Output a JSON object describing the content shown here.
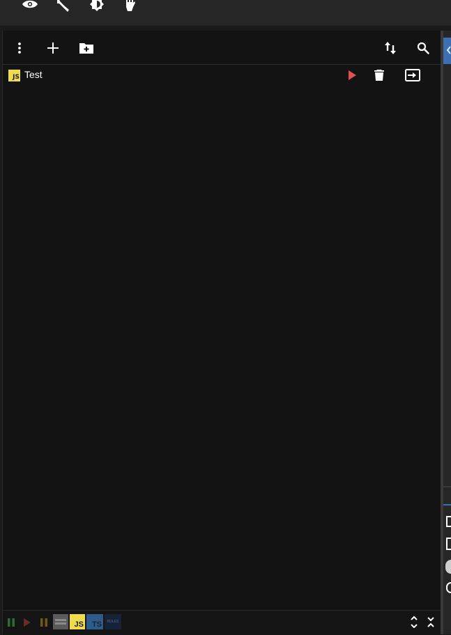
{
  "top_toolbar": {
    "icons": [
      "eye-icon",
      "wrench-icon",
      "brightness-icon",
      "hand-icon"
    ]
  },
  "panel_toolbar": {
    "icons_left": [
      "more-vertical-icon",
      "plus-icon",
      "folder-plus-icon"
    ],
    "icons_right": [
      "sort-icon",
      "search-icon"
    ]
  },
  "scripts": [
    {
      "name": "Test",
      "type_badge": "JS"
    }
  ],
  "statusbar": {
    "badges": [
      "JS",
      "TS",
      "RULES"
    ]
  },
  "colors": {
    "accent": "#3d6fb0",
    "run": "#e05252",
    "js_yellow": "#f0db4f",
    "ts_blue": "#2f5b8a"
  }
}
